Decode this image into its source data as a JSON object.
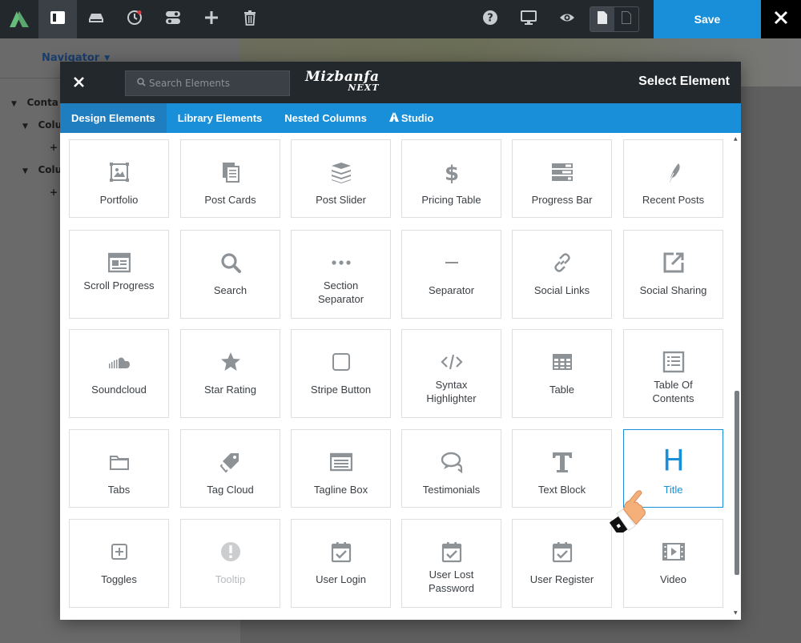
{
  "toolbar": {
    "save_label": "Save",
    "accent": "#198fd9"
  },
  "navigator": {
    "title": "Navigator",
    "tree": [
      "Conta",
      "Colu",
      "+",
      "Colu",
      "+"
    ]
  },
  "modal": {
    "title": "Select Element",
    "search_placeholder": "Search Elements",
    "brand_top": "Mizbanfa",
    "brand_bottom": "NEXT",
    "tabs": [
      "Design Elements",
      "Library Elements",
      "Nested Columns",
      "Studio"
    ],
    "elements": [
      {
        "label": "Portfolio",
        "icon": "image-frame-icon"
      },
      {
        "label": "Post Cards",
        "icon": "copy-icon"
      },
      {
        "label": "Post Slider",
        "icon": "layers-icon"
      },
      {
        "label": "Pricing Table",
        "icon": "dollar-icon"
      },
      {
        "label": "Progress Bar",
        "icon": "progress-bars-icon"
      },
      {
        "label": "Recent Posts",
        "icon": "feather-icon"
      },
      {
        "label": "Scroll Progress",
        "icon": "newspaper-icon"
      },
      {
        "label": "Search",
        "icon": "search-icon"
      },
      {
        "label": "Section Separator",
        "icon": "dots-icon"
      },
      {
        "label": "Separator",
        "icon": "minus-icon"
      },
      {
        "label": "Social Links",
        "icon": "link-icon"
      },
      {
        "label": "Social Sharing",
        "icon": "external-link-icon"
      },
      {
        "label": "Soundcloud",
        "icon": "soundcloud-icon"
      },
      {
        "label": "Star Rating",
        "icon": "star-icon"
      },
      {
        "label": "Stripe Button",
        "icon": "square-icon"
      },
      {
        "label": "Syntax Highlighter",
        "icon": "code-icon"
      },
      {
        "label": "Table",
        "icon": "table-icon"
      },
      {
        "label": "Table Of Contents",
        "icon": "list-box-icon"
      },
      {
        "label": "Tabs",
        "icon": "folder-icon"
      },
      {
        "label": "Tag Cloud",
        "icon": "tags-icon"
      },
      {
        "label": "Tagline Box",
        "icon": "tagline-icon"
      },
      {
        "label": "Testimonials",
        "icon": "chat-bubbles-icon"
      },
      {
        "label": "Text Block",
        "icon": "text-t-icon"
      },
      {
        "label": "Title",
        "icon": "heading-h-icon"
      },
      {
        "label": "Toggles",
        "icon": "plus-square-icon"
      },
      {
        "label": "Tooltip",
        "icon": "exclamation-circle-icon"
      },
      {
        "label": "User Login",
        "icon": "calendar-check-icon"
      },
      {
        "label": "User Lost Password",
        "icon": "calendar-check-icon"
      },
      {
        "label": "User Register",
        "icon": "calendar-check-icon"
      },
      {
        "label": "Video",
        "icon": "film-icon"
      }
    ]
  }
}
